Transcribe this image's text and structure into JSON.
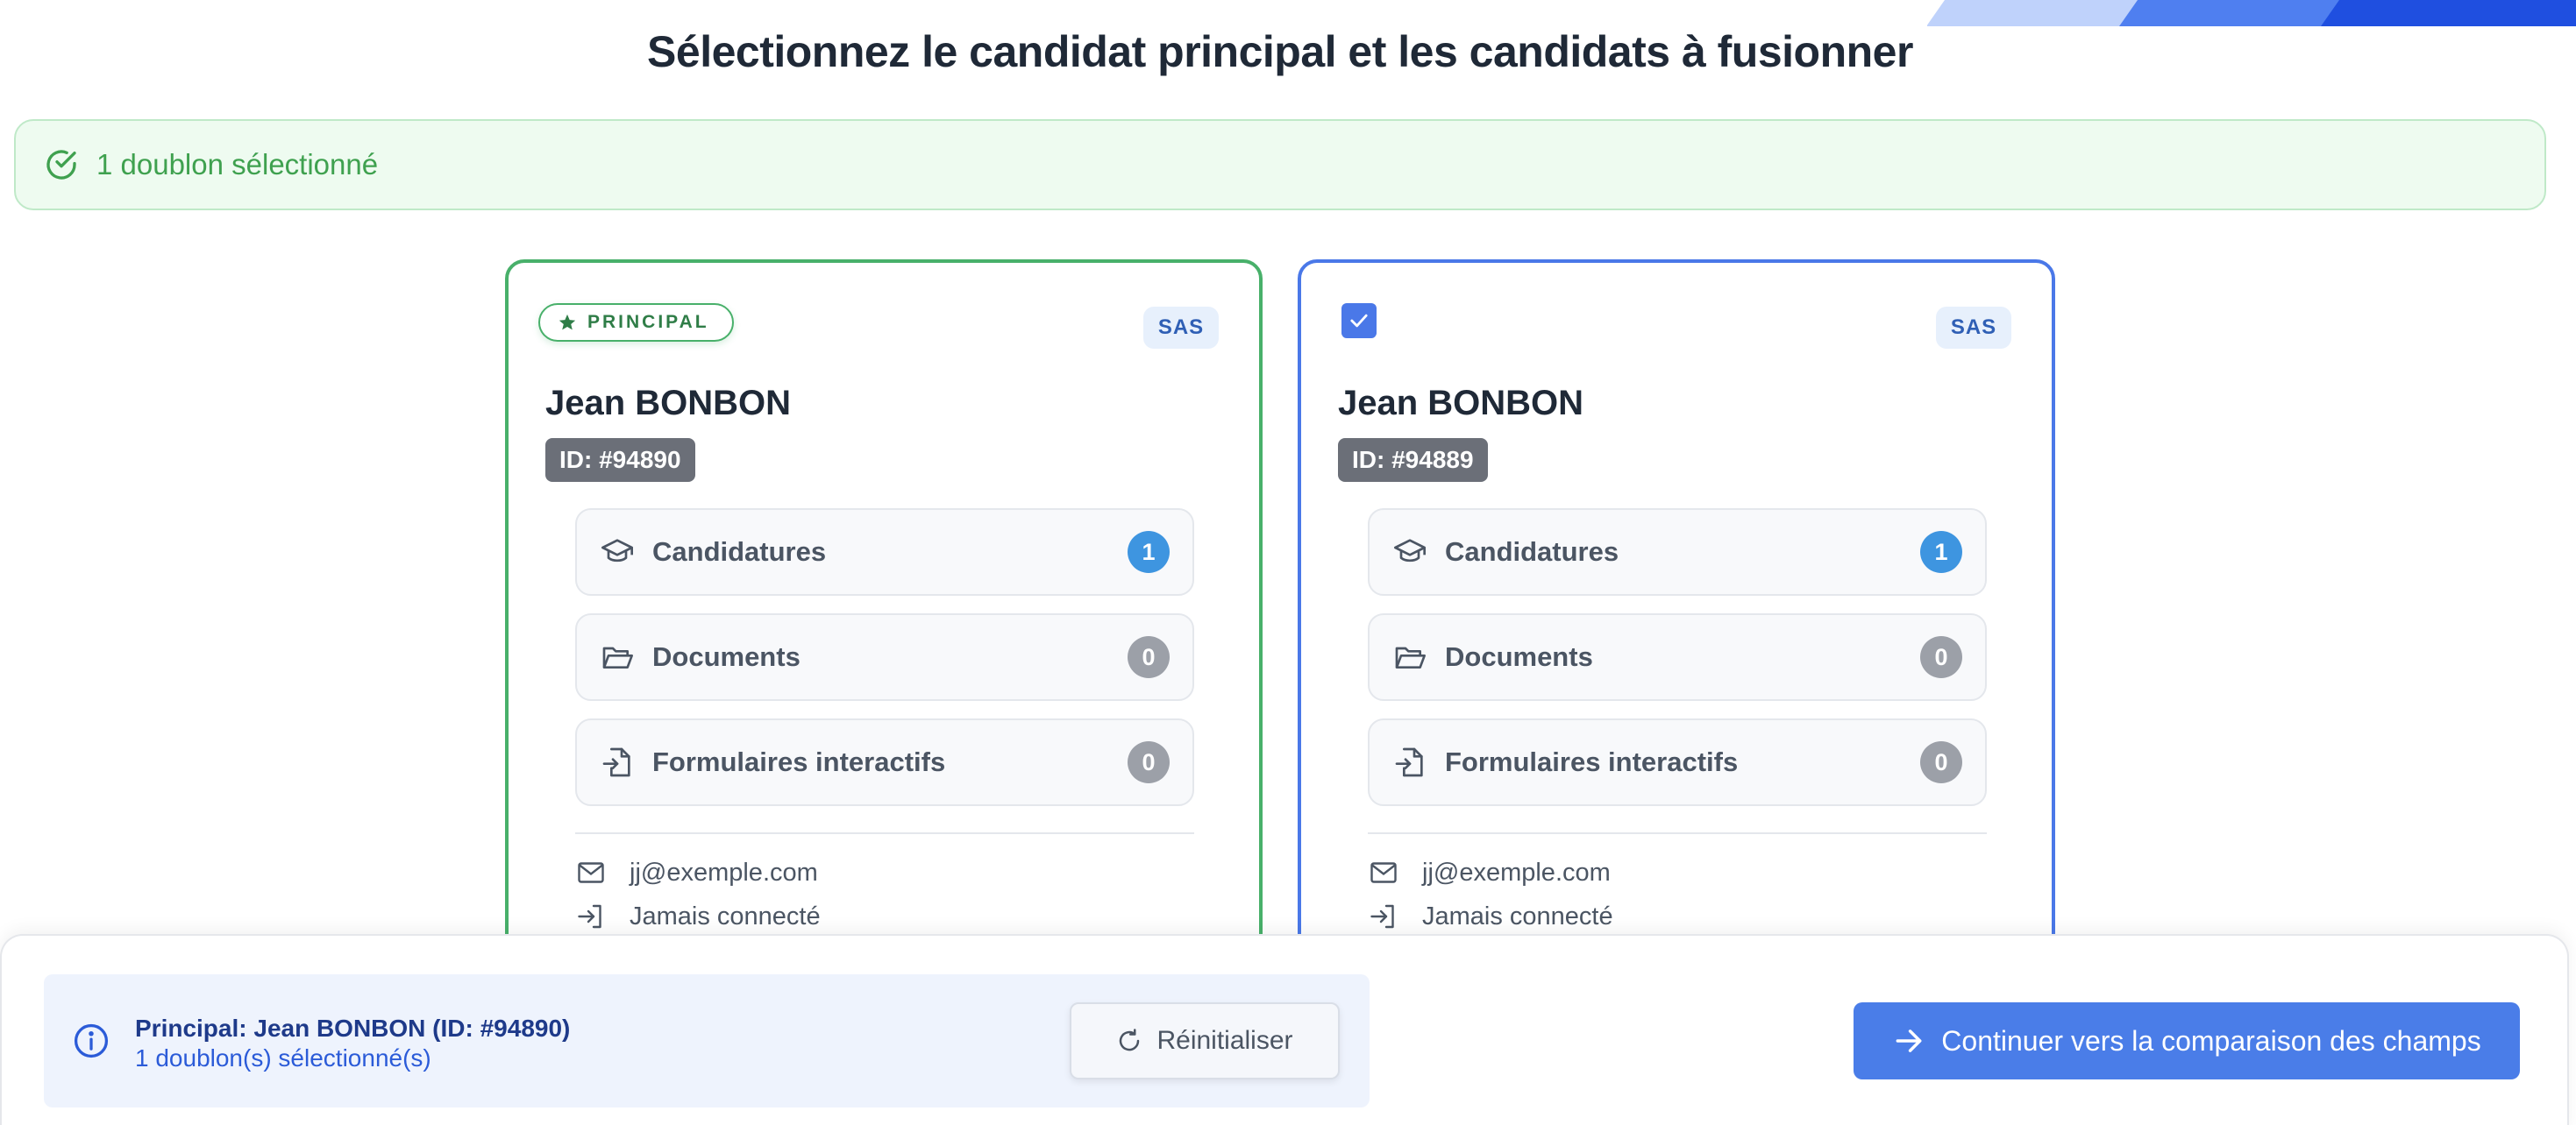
{
  "header": {
    "title": "Sélectionnez le candidat principal et les candidats à fusionner"
  },
  "alert": {
    "text": "1 doublon sélectionné",
    "icon": "check-circle-icon",
    "color": "#3fa14f"
  },
  "candidates": [
    {
      "role": "principal",
      "badge": "PRINCIPAL",
      "checked": false,
      "entity": "SAS",
      "name": "Jean BONBON",
      "id_label": "ID: #94890",
      "stats": [
        {
          "label": "Candidatures",
          "count": "1",
          "icon": "graduation-cap-icon"
        },
        {
          "label": "Documents",
          "count": "0",
          "icon": "folder-open-icon"
        },
        {
          "label": "Formulaires interactifs",
          "count": "0",
          "icon": "file-import-icon"
        }
      ],
      "email": "jj@exemple.com",
      "last_login": "Jamais connecté",
      "border_color": "#48b06a"
    },
    {
      "role": "duplicate",
      "badge": "",
      "checked": true,
      "entity": "SAS",
      "name": "Jean BONBON",
      "id_label": "ID: #94889",
      "stats": [
        {
          "label": "Candidatures",
          "count": "1",
          "icon": "graduation-cap-icon"
        },
        {
          "label": "Documents",
          "count": "0",
          "icon": "folder-open-icon"
        },
        {
          "label": "Formulaires interactifs",
          "count": "0",
          "icon": "file-import-icon"
        }
      ],
      "email": "jj@exemple.com",
      "last_login": "Jamais connecté",
      "border_color": "#4a78e8"
    }
  ],
  "footer": {
    "summary_principal": "Principal: Jean BONBON (ID: #94890)",
    "summary_duplicates": "1 doublon(s) sélectionné(s)",
    "reset_label": "Réinitialiser",
    "continue_label": "Continuer vers la comparaison des champs",
    "accent": "#4a7de8"
  }
}
